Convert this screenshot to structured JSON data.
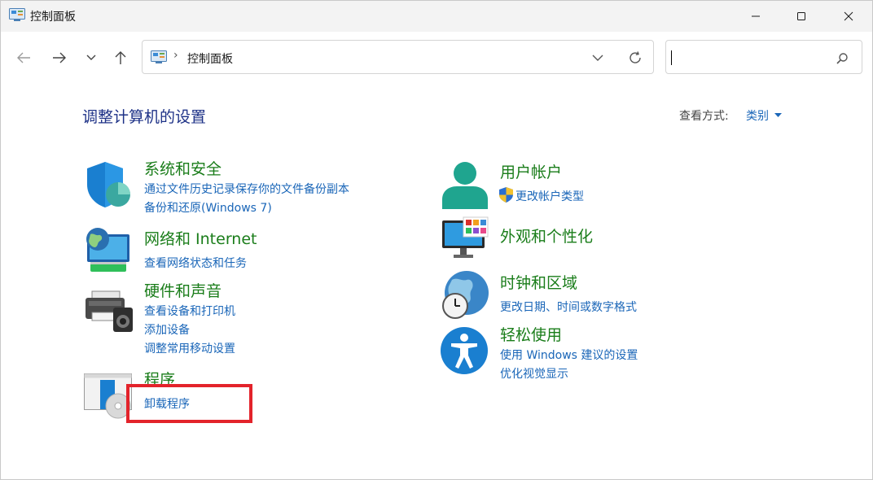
{
  "window": {
    "title": "控制面板",
    "app_icon": "control-panel-icon",
    "controls": [
      "minimize-icon",
      "maximize-icon",
      "close-icon"
    ]
  },
  "nav": {
    "address_icon": "control-panel-icon",
    "address_separator": "›",
    "address_text": "控制面板",
    "search_value": ""
  },
  "main": {
    "title": "调整计算机的设置",
    "view_by_label": "查看方式:",
    "view_by_value": "类别"
  },
  "categories": {
    "system_security": {
      "title": "系统和安全",
      "links": [
        "通过文件历史记录保存你的文件备份副本",
        "备份和还原(Windows 7)"
      ]
    },
    "network": {
      "title": "网络和 Internet",
      "links": [
        "查看网络状态和任务"
      ]
    },
    "hardware": {
      "title": "硬件和声音",
      "links": [
        "查看设备和打印机",
        "添加设备",
        "调整常用移动设置"
      ]
    },
    "programs": {
      "title": "程序",
      "links": [
        "卸载程序"
      ]
    },
    "user_accounts": {
      "title": "用户帐户",
      "links": [
        "更改帐户类型"
      ]
    },
    "appearance": {
      "title": "外观和个性化",
      "links": []
    },
    "clock_region": {
      "title": "时钟和区域",
      "links": [
        "更改日期、时间或数字格式"
      ]
    },
    "ease_of_access": {
      "title": "轻松使用",
      "links": [
        "使用 Windows 建议的设置",
        "优化视觉显示"
      ]
    }
  },
  "colors": {
    "category_title": "#1a7d1a",
    "link": "#1a66b8",
    "page_title": "#1e3287",
    "highlight": "#e3232b"
  }
}
